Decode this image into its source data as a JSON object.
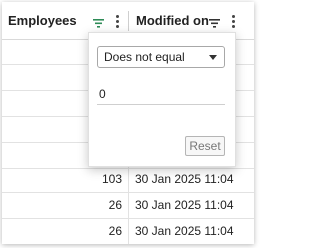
{
  "columns": {
    "employees": "Employees",
    "modified_on": "Modified on"
  },
  "rows": [
    {
      "employees": "103",
      "modified_on": "30 Jan 2025 11:04"
    },
    {
      "employees": "26",
      "modified_on": "30 Jan 2025 11:04"
    },
    {
      "employees": "26",
      "modified_on": "30 Jan 2025 11:04"
    }
  ],
  "filter_popup": {
    "operator": "Does not equal",
    "value": "0",
    "reset_label": "Reset"
  },
  "icons": {
    "employees_filter": "filter-icon",
    "employees_menu": "column-menu-icon",
    "modified_filter": "filter-icon",
    "modified_menu": "column-menu-icon",
    "dropdown": "chevron-down-icon"
  },
  "colors": {
    "active_filter": "#2e8b57",
    "inactive_filter": "#333333"
  }
}
